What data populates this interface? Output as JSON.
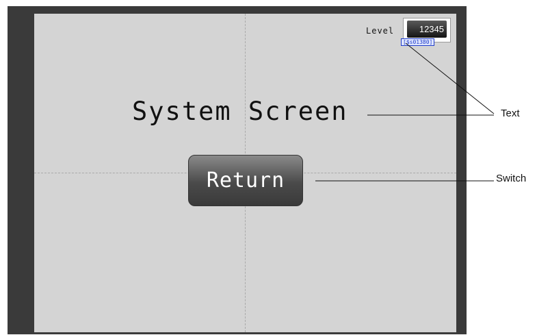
{
  "screen": {
    "title": "System Screen",
    "level": {
      "label": "Level",
      "value": "12345",
      "address": "[$s01380]"
    },
    "return_button": {
      "label": "Return"
    }
  },
  "callouts": {
    "text_label": "Text",
    "switch_label": "Switch"
  },
  "colors": {
    "screen_background": "#d4d4d4",
    "frame": "#3a3a3a",
    "button": "#5a5a5a",
    "address_tag": "#1f3cc9"
  }
}
